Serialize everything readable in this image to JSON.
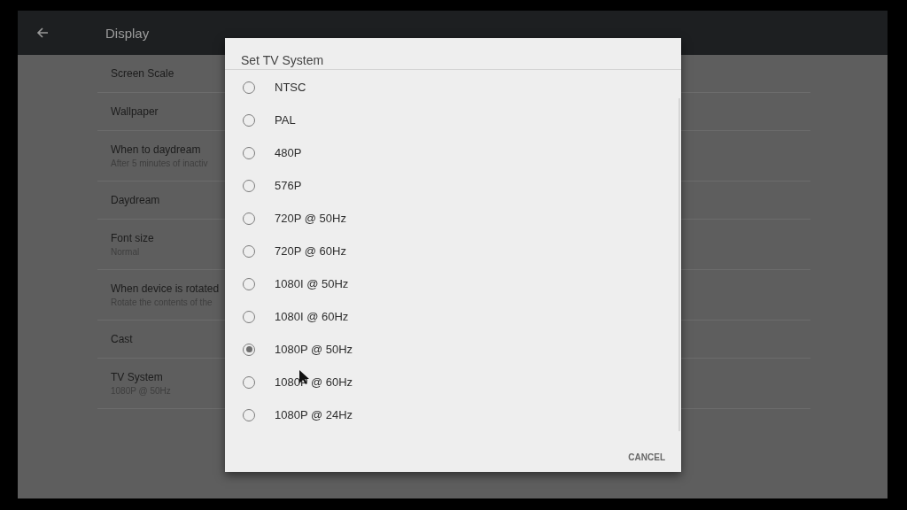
{
  "header": {
    "title": "Display"
  },
  "settings": [
    {
      "title": "Screen Scale"
    },
    {
      "title": "Wallpaper"
    },
    {
      "title": "When to daydream",
      "summary": "After 5 minutes of inactiv"
    },
    {
      "title": "Daydream"
    },
    {
      "title": "Font size",
      "summary": "Normal"
    },
    {
      "title": "When device is rotated",
      "summary": "Rotate the contents of the"
    },
    {
      "title": "Cast"
    },
    {
      "title": "TV System",
      "summary": "1080P @ 50Hz"
    }
  ],
  "dialog": {
    "title": "Set TV System",
    "options": [
      {
        "label": "NTSC",
        "selected": false
      },
      {
        "label": "PAL",
        "selected": false
      },
      {
        "label": "480P",
        "selected": false
      },
      {
        "label": "576P",
        "selected": false
      },
      {
        "label": "720P @ 50Hz",
        "selected": false
      },
      {
        "label": "720P @ 60Hz",
        "selected": false
      },
      {
        "label": "1080I @ 50Hz",
        "selected": false
      },
      {
        "label": "1080I @ 60Hz",
        "selected": false
      },
      {
        "label": "1080P @ 50Hz",
        "selected": true
      },
      {
        "label": "1080P @ 60Hz",
        "selected": false
      },
      {
        "label": "1080P @ 24Hz",
        "selected": false
      }
    ],
    "buttons": [
      "CANCEL"
    ]
  }
}
